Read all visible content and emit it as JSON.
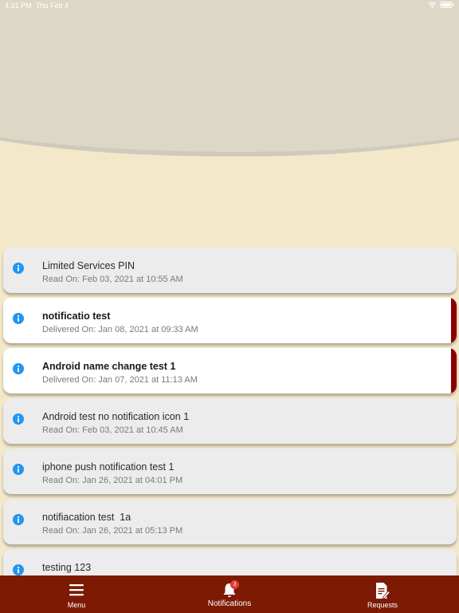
{
  "status_bar": {
    "time": "4:31 PM",
    "date": "Thu Feb 4"
  },
  "notifications": [
    {
      "title": "Limited Services PIN",
      "subtitle": "Read On: Feb 03, 2021 at 10:55 AM",
      "unread": false,
      "icon": "info-icon"
    },
    {
      "title": "notificatio test",
      "subtitle": "Delivered On: Jan 08, 2021 at 09:33 AM",
      "unread": true,
      "icon": "info-icon"
    },
    {
      "title": "Android name change test 1",
      "subtitle": "Delivered On: Jan 07, 2021 at 11:13 AM",
      "unread": true,
      "icon": "info-icon"
    },
    {
      "title": "Android test no notification icon 1",
      "subtitle": "Read On: Feb 03, 2021 at 10:45 AM",
      "unread": false,
      "icon": "info-icon"
    },
    {
      "title": "iphone push notification test 1",
      "subtitle": "Read On: Jan 26, 2021 at 04:01 PM",
      "unread": false,
      "icon": "info-icon"
    },
    {
      "title": "notifiacation test  1a",
      "subtitle": "Read On: Jan 26, 2021 at 05:13 PM",
      "unread": false,
      "icon": "info-icon"
    },
    {
      "title": "testing 123",
      "subtitle": "",
      "unread": false,
      "icon": "info-icon"
    }
  ],
  "tabbar": {
    "menu_label": "Menu",
    "notifications_label": "Notifications",
    "notifications_badge": "3",
    "requests_label": "Requests"
  },
  "colors": {
    "background": "#f3e8c9",
    "header": "#ddd8c5",
    "tabbar": "#7d1a04",
    "unread_marker": "#8b0000",
    "info_icon": "#2196f3",
    "badge": "#e53935"
  }
}
